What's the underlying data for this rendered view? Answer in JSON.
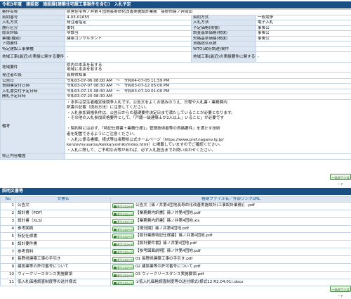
{
  "title": "令和3年度　建設部　施設課(建築住宅課工事案件を含む)　入札予定",
  "info_rows": [
    {
      "k1": "案件名称",
      "v1": "県営住宅等ノ井第４団地長寿命化改善実施設計業務　長野市篠ノ井岡田",
      "k2": "",
      "v2": "",
      "full": true
    },
    {
      "k1": "契約番号",
      "v1": "4-03-01655",
      "k2": "契約方式",
      "v2": "一般競争"
    },
    {
      "k1": "入札方式",
      "v1": "発注者指定",
      "k2": "入札方法",
      "v2": "電子入札"
    },
    {
      "k1": "施行区分",
      "v1": "委託",
      "k2": "予定価格(税抜)",
      "v2": "事後公"
    },
    {
      "k1": "総合評価",
      "v1": "非該当",
      "k2": "調査基準価格(税抜)",
      "v2": "事後公"
    },
    {
      "k1": "業種(種別)",
      "v1": "建築コンサルタント",
      "k2": "失格基準価格(税抜)",
      "v2": "事後公"
    },
    {
      "k1": "下請要件",
      "v1": "",
      "k2": "資格総合点数",
      "v2": ""
    },
    {
      "k1": "特定建設工事業種",
      "v1": "",
      "k2": "WTO(政府調達)案件",
      "v2": ""
    },
    {
      "k1": "地域工事(最近)の実績に関する要件",
      "v1": "-",
      "k2": "地域工事(最近)の実績要件に関する要件",
      "v2": "-",
      "tall": true
    },
    {
      "k1": "地域要件",
      "v1": "県内の本店を有する",
      "v1b": "地域に本店を有する",
      "k2": "",
      "v2": "",
      "full": true,
      "tall": true
    },
    {
      "k1": "発注者の長",
      "v1": "長野県知事",
      "k2": "",
      "v2": "",
      "full": true
    },
    {
      "k1": "公告日",
      "v1": "令和03-07-06 08:00 AM　～　令和04-07-05 11:59 PM",
      "k2": "",
      "v2": "",
      "full": true
    },
    {
      "k1": "質問書受付日時",
      "v1": "令和03-07-07 08:30 AM　～　令和03-07-12 05:00 PM",
      "k2": "",
      "v2": "",
      "full": true
    },
    {
      "k1": "入札書受付予定日時",
      "v1": "令和03-07-15 08:30 AM　～　令和03-07-19 01:00 PM",
      "k2": "",
      "v2": "",
      "full": true
    },
    {
      "k1": "開札予定日時",
      "v1": "令和03-07-20 08:30 AM",
      "k2": "",
      "v2": "",
      "full": true
    }
  ],
  "notes": {
    "label": "備考",
    "lines": [
      "・本件は受注者確定後競争入札です。公告文をよくお読みのうえ、日程や入札書・業務費内",
      "訳書の記載（提出方法）に注意してください。",
      "・入札参加資格条件は、公告日からの基礎要件決定日まで満たしていることが必要となります。",
      "・その他の入札参加資格要件として、「戸籍一級建築士が2人以上」いること」が必要です",
      "",
      "・契約時には必ず、「特記仕様書＋業務仕様1」管理技術者等の資格要件」を満たす技術",
      "者を配置できるようにご注意ください。",
      "・入札に係る書類、様式等は長野県公式ホームページ（https://www.pref.nagano.lg.jp/",
      "kenzei/nyusatsu/kekka/yoshiki/index.html）に掲載していますのでご確認ください。",
      "・入札に際して、ご不明な点等があれば、必ず入札担当までお問い合わせください。"
    ]
  },
  "revision": {
    "label": "修正内容履歴",
    "value": ""
  },
  "download_all_label": "一括ダウンロード",
  "docs_title": "説明文書等",
  "docs_headers": {
    "no": "No",
    "name": "文書名",
    "file": "格納ファイル名／外部リンクURL"
  },
  "dl_label": "ダウンロード",
  "docs": [
    {
      "no": "1",
      "name": "公告文",
      "file": "公告文［篠ノ井第4団地長寿命化改善実施設計(工事設計業務)］.pdf"
    },
    {
      "no": "2",
      "name": "設計書（PDF）",
      "file": "【業務費内訳書】篠ノ井第4団地.pdf"
    },
    {
      "no": "3",
      "name": "設計書（XLS）",
      "file": "【業務費内訳書】篠ノ井第4団地.xls"
    },
    {
      "no": "4",
      "name": "参考図面",
      "file": "【現況図】篠ノ井第4団地.pdf"
    },
    {
      "no": "5",
      "name": "特記仕様書",
      "file": "【設計業務特記仕様書】篠ノ井第4団地.pdf"
    },
    {
      "no": "6",
      "name": "設計要件書",
      "file": "【設計要件書】篠ノ井第4団地.pdf"
    },
    {
      "no": "7",
      "name": "参考資料",
      "file": "【参考図面説明】篠ノ井第4団地.pdf"
    },
    {
      "no": "8",
      "name": "長野県建築工事の手引き",
      "file": "01 長野県建築工事の手引き.pdf"
    },
    {
      "no": "9",
      "name": "建設業等の許可番号について",
      "file": "02 建設業等の許可番号について.pdf"
    },
    {
      "no": "10",
      "name": "ウィークリースタンス実施要領",
      "file": "03 ウィークリースタンス実施要領.pdf"
    },
    {
      "no": "11",
      "name": "低入札価格調査制度等の送付様式",
      "file": "①低入札価格調査制度等の送付様式(様式12 R2.04.01).docx"
    }
  ]
}
